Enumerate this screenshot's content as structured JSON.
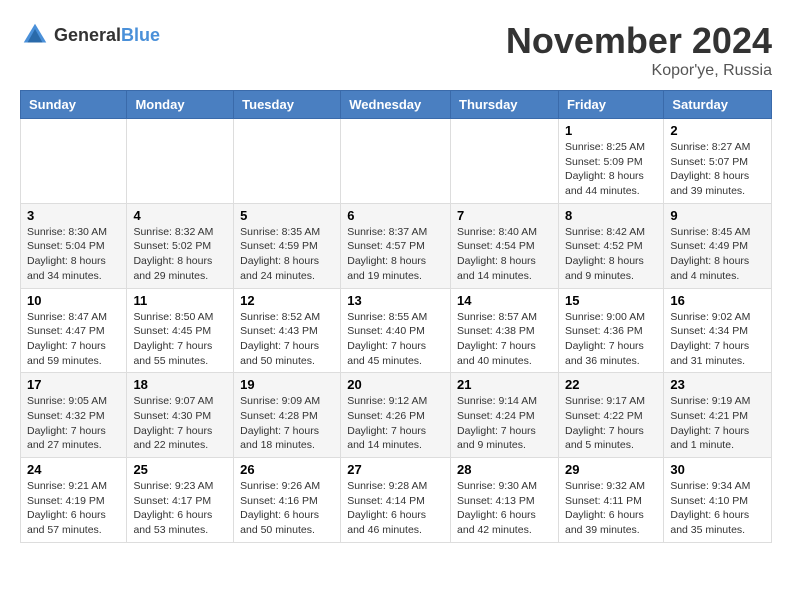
{
  "logo": {
    "text_general": "General",
    "text_blue": "Blue"
  },
  "header": {
    "month": "November 2024",
    "location": "Kopor'ye, Russia"
  },
  "weekdays": [
    "Sunday",
    "Monday",
    "Tuesday",
    "Wednesday",
    "Thursday",
    "Friday",
    "Saturday"
  ],
  "weeks": [
    [
      {
        "day": "",
        "sunrise": "",
        "sunset": "",
        "daylight": ""
      },
      {
        "day": "",
        "sunrise": "",
        "sunset": "",
        "daylight": ""
      },
      {
        "day": "",
        "sunrise": "",
        "sunset": "",
        "daylight": ""
      },
      {
        "day": "",
        "sunrise": "",
        "sunset": "",
        "daylight": ""
      },
      {
        "day": "",
        "sunrise": "",
        "sunset": "",
        "daylight": ""
      },
      {
        "day": "1",
        "sunrise": "Sunrise: 8:25 AM",
        "sunset": "Sunset: 5:09 PM",
        "daylight": "Daylight: 8 hours and 44 minutes."
      },
      {
        "day": "2",
        "sunrise": "Sunrise: 8:27 AM",
        "sunset": "Sunset: 5:07 PM",
        "daylight": "Daylight: 8 hours and 39 minutes."
      }
    ],
    [
      {
        "day": "3",
        "sunrise": "Sunrise: 8:30 AM",
        "sunset": "Sunset: 5:04 PM",
        "daylight": "Daylight: 8 hours and 34 minutes."
      },
      {
        "day": "4",
        "sunrise": "Sunrise: 8:32 AM",
        "sunset": "Sunset: 5:02 PM",
        "daylight": "Daylight: 8 hours and 29 minutes."
      },
      {
        "day": "5",
        "sunrise": "Sunrise: 8:35 AM",
        "sunset": "Sunset: 4:59 PM",
        "daylight": "Daylight: 8 hours and 24 minutes."
      },
      {
        "day": "6",
        "sunrise": "Sunrise: 8:37 AM",
        "sunset": "Sunset: 4:57 PM",
        "daylight": "Daylight: 8 hours and 19 minutes."
      },
      {
        "day": "7",
        "sunrise": "Sunrise: 8:40 AM",
        "sunset": "Sunset: 4:54 PM",
        "daylight": "Daylight: 8 hours and 14 minutes."
      },
      {
        "day": "8",
        "sunrise": "Sunrise: 8:42 AM",
        "sunset": "Sunset: 4:52 PM",
        "daylight": "Daylight: 8 hours and 9 minutes."
      },
      {
        "day": "9",
        "sunrise": "Sunrise: 8:45 AM",
        "sunset": "Sunset: 4:49 PM",
        "daylight": "Daylight: 8 hours and 4 minutes."
      }
    ],
    [
      {
        "day": "10",
        "sunrise": "Sunrise: 8:47 AM",
        "sunset": "Sunset: 4:47 PM",
        "daylight": "Daylight: 7 hours and 59 minutes."
      },
      {
        "day": "11",
        "sunrise": "Sunrise: 8:50 AM",
        "sunset": "Sunset: 4:45 PM",
        "daylight": "Daylight: 7 hours and 55 minutes."
      },
      {
        "day": "12",
        "sunrise": "Sunrise: 8:52 AM",
        "sunset": "Sunset: 4:43 PM",
        "daylight": "Daylight: 7 hours and 50 minutes."
      },
      {
        "day": "13",
        "sunrise": "Sunrise: 8:55 AM",
        "sunset": "Sunset: 4:40 PM",
        "daylight": "Daylight: 7 hours and 45 minutes."
      },
      {
        "day": "14",
        "sunrise": "Sunrise: 8:57 AM",
        "sunset": "Sunset: 4:38 PM",
        "daylight": "Daylight: 7 hours and 40 minutes."
      },
      {
        "day": "15",
        "sunrise": "Sunrise: 9:00 AM",
        "sunset": "Sunset: 4:36 PM",
        "daylight": "Daylight: 7 hours and 36 minutes."
      },
      {
        "day": "16",
        "sunrise": "Sunrise: 9:02 AM",
        "sunset": "Sunset: 4:34 PM",
        "daylight": "Daylight: 7 hours and 31 minutes."
      }
    ],
    [
      {
        "day": "17",
        "sunrise": "Sunrise: 9:05 AM",
        "sunset": "Sunset: 4:32 PM",
        "daylight": "Daylight: 7 hours and 27 minutes."
      },
      {
        "day": "18",
        "sunrise": "Sunrise: 9:07 AM",
        "sunset": "Sunset: 4:30 PM",
        "daylight": "Daylight: 7 hours and 22 minutes."
      },
      {
        "day": "19",
        "sunrise": "Sunrise: 9:09 AM",
        "sunset": "Sunset: 4:28 PM",
        "daylight": "Daylight: 7 hours and 18 minutes."
      },
      {
        "day": "20",
        "sunrise": "Sunrise: 9:12 AM",
        "sunset": "Sunset: 4:26 PM",
        "daylight": "Daylight: 7 hours and 14 minutes."
      },
      {
        "day": "21",
        "sunrise": "Sunrise: 9:14 AM",
        "sunset": "Sunset: 4:24 PM",
        "daylight": "Daylight: 7 hours and 9 minutes."
      },
      {
        "day": "22",
        "sunrise": "Sunrise: 9:17 AM",
        "sunset": "Sunset: 4:22 PM",
        "daylight": "Daylight: 7 hours and 5 minutes."
      },
      {
        "day": "23",
        "sunrise": "Sunrise: 9:19 AM",
        "sunset": "Sunset: 4:21 PM",
        "daylight": "Daylight: 7 hours and 1 minute."
      }
    ],
    [
      {
        "day": "24",
        "sunrise": "Sunrise: 9:21 AM",
        "sunset": "Sunset: 4:19 PM",
        "daylight": "Daylight: 6 hours and 57 minutes."
      },
      {
        "day": "25",
        "sunrise": "Sunrise: 9:23 AM",
        "sunset": "Sunset: 4:17 PM",
        "daylight": "Daylight: 6 hours and 53 minutes."
      },
      {
        "day": "26",
        "sunrise": "Sunrise: 9:26 AM",
        "sunset": "Sunset: 4:16 PM",
        "daylight": "Daylight: 6 hours and 50 minutes."
      },
      {
        "day": "27",
        "sunrise": "Sunrise: 9:28 AM",
        "sunset": "Sunset: 4:14 PM",
        "daylight": "Daylight: 6 hours and 46 minutes."
      },
      {
        "day": "28",
        "sunrise": "Sunrise: 9:30 AM",
        "sunset": "Sunset: 4:13 PM",
        "daylight": "Daylight: 6 hours and 42 minutes."
      },
      {
        "day": "29",
        "sunrise": "Sunrise: 9:32 AM",
        "sunset": "Sunset: 4:11 PM",
        "daylight": "Daylight: 6 hours and 39 minutes."
      },
      {
        "day": "30",
        "sunrise": "Sunrise: 9:34 AM",
        "sunset": "Sunset: 4:10 PM",
        "daylight": "Daylight: 6 hours and 35 minutes."
      }
    ]
  ]
}
